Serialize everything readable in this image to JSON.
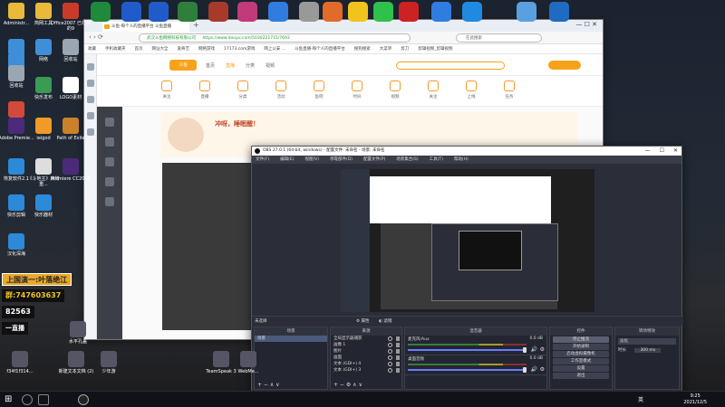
{
  "desktop": {
    "left_icons": [
      {
        "label": "Administr...",
        "color": "#e8b93a"
      },
      {
        "label": "此电脑",
        "color": "#3e8ed8"
      },
      {
        "label": "网络",
        "color": "#3e8ed8"
      },
      {
        "label": "回收站",
        "color": "#9aa6b2"
      },
      {
        "label": "爱剪辑",
        "color": "#d24a3a"
      },
      {
        "label": "Adobe Premie...",
        "color": "#4b2a79"
      },
      {
        "label": "恢复软件2.1",
        "color": "#2c8ad8"
      },
      {
        "label": "快乐剪辑",
        "color": "#2c8ad8"
      },
      {
        "label": "汉化深海",
        "color": "#2c8ad8"
      }
    ],
    "col2_icons": [
      {
        "label": "简网工具",
        "color": "#e8b93a"
      },
      {
        "label": "网络",
        "color": "#3e8ed8"
      },
      {
        "label": "快乐发布",
        "color": "#3a9b55"
      },
      {
        "label": "ieigod",
        "color": "#f09a27"
      },
      {
        "label": "《斗地主》麻将重...",
        "color": "#ddd"
      },
      {
        "label": "快乐器材",
        "color": "#2c8ad8"
      }
    ],
    "col3_icons": [
      {
        "label": "Office2007 已打开的9",
        "color": "#c93a2a"
      },
      {
        "label": "回收站",
        "color": "#9aa6b2"
      },
      {
        "label": "LOGO素材",
        "color": "#ffffff"
      },
      {
        "label": "Path of Exile",
        "color": "#c9812a"
      },
      {
        "label": "Premiere CC2018",
        "color": "#4b2a79"
      }
    ],
    "bottom_icons": [
      {
        "label": "f34f1f314..."
      },
      {
        "label": "新建文本文档 (2)"
      },
      {
        "label": "少年游"
      },
      {
        "label": "TeamSpeak 3"
      },
      {
        "label": "WebMe..."
      },
      {
        "label": "水平孔盖"
      }
    ],
    "top_tray_colors": [
      "#1f8a3a",
      "#1f5bc9",
      "#1f5bc9",
      "#2e7f3b",
      "#a83a2a",
      "#c13a7a",
      "#2f7de0",
      "#999",
      "#e06b2a",
      "#f2c41b",
      "#2ec24a",
      "#c22",
      "#2f7de0",
      "#1f8ae0",
      "#5aa0e0",
      "#1f6ac2"
    ]
  },
  "overlay": {
    "name_badge": "上国演一:叶落绝江",
    "qq_line": "群:747603637",
    "id_line": "82563",
    "misc_line": "一直播"
  },
  "browser": {
    "tab_title": "斗鱼-每个人的直播平台 斗鱼直播",
    "url_label": "武汉斗鱼网络科技有限公司",
    "url": "https://www.douyu.com/5030221715/7693",
    "search_placeholder": "在此搜索",
    "bookmarks": [
      "收藏",
      "手机收藏夹",
      "首页",
      "网址大全",
      "爱奇艺",
      "网络游戏",
      "17173.com游戏",
      "网上公安 ...",
      "斗鱼直播-每个人的直播平台",
      "搜狗搜索",
      "大菜单",
      "剪刀",
      "剪辑视频_剪辑视频"
    ],
    "nav": [
      "首页",
      "直播",
      "分类",
      "视频"
    ],
    "cats": [
      "关注",
      "直播",
      "分类",
      "活动",
      "鱼吧",
      "时间",
      "视频",
      "关注",
      "上线",
      "任务"
    ],
    "promo_title": "冲呀，睡眠醒！",
    "logo_text": "斗鱼"
  },
  "obs": {
    "title": "OBS 27.0.1 (64-bit, windows) - 配置文件: 未命名 - 场景: 未命名",
    "menu": [
      "文件(F)",
      "编辑(E)",
      "视图(V)",
      "停靠部件(D)",
      "配置文件(P)",
      "场景集合(S)",
      "工具(T)",
      "帮助(H)"
    ],
    "toolbar": {
      "current_scene": "未选择",
      "properties": "属性",
      "filters": "滤镜"
    },
    "docks": {
      "scenes": "场景",
      "sources": "来源",
      "mixer": "混音器",
      "controls": "控件",
      "transitions": "转场特效"
    },
    "scene_list": [
      "场景"
    ],
    "sources": [
      "全局显示器捕获",
      "画像 1",
      "图片",
      "画面",
      "文本 (GDI+) 4",
      "文本 (GDI+) 3"
    ],
    "mixer": [
      {
        "name": "麦克风/Aux",
        "db": "0.0 dB"
      },
      {
        "name": "桌面音频",
        "db": "0.0 dB"
      }
    ],
    "controls": [
      "停止推流",
      "开始录制",
      "启动虚拟摄像机",
      "工作室模式",
      "设置",
      "退出"
    ],
    "transition": {
      "type": "淡化",
      "duration_label": "时长",
      "duration": "300 ms"
    },
    "status": "LIVE: 00:00:05  REC: 00:00:00  CPU: 3.6%, 30.00 fps"
  },
  "taskbar": {
    "time": "9:25",
    "date": "2021/12/5",
    "lang": "英"
  }
}
